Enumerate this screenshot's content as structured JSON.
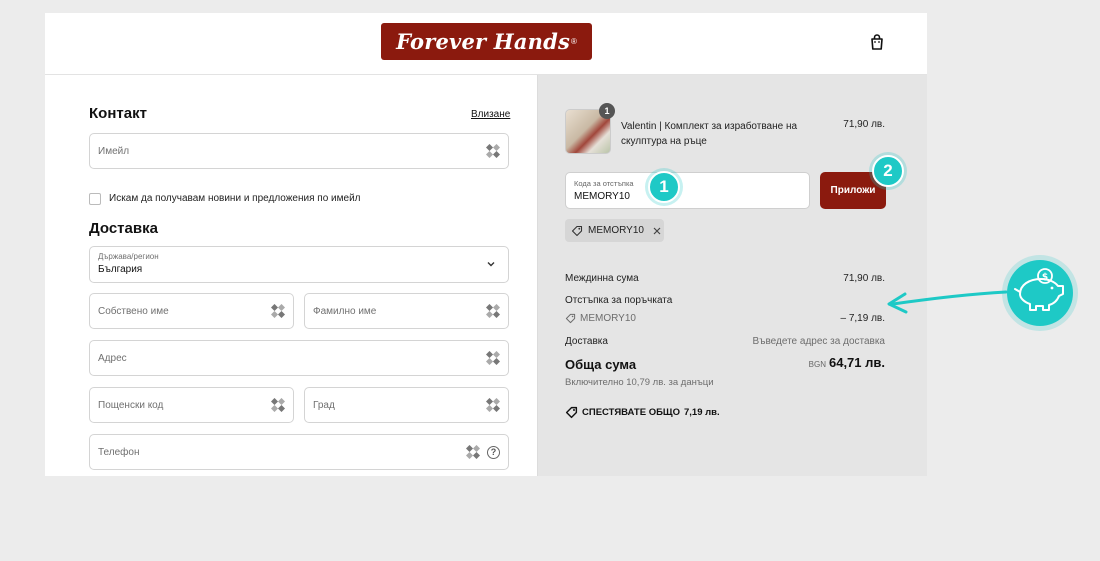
{
  "header": {
    "logo_text": "Forever Hands",
    "logo_mark": "®",
    "cart_icon": "shopping-bag-icon"
  },
  "contact": {
    "heading": "Контакт",
    "login_link": "Влизане",
    "email_placeholder": "Имейл",
    "newsletter_label": "Искам да получавам новини и предложения по имейл"
  },
  "delivery": {
    "heading": "Доставка",
    "country_label": "Държава/регион",
    "country_value": "България",
    "first_name_placeholder": "Собствено име",
    "last_name_placeholder": "Фамилно име",
    "address_placeholder": "Адрес",
    "postcode_placeholder": "Пощенски код",
    "city_placeholder": "Град",
    "phone_placeholder": "Телефон",
    "help_glyph": "?"
  },
  "summary": {
    "product": {
      "qty": "1",
      "name": "Valentin | Комплект за изработване на скулптура на ръце",
      "price": "71,90 лв."
    },
    "discount_field": {
      "label": "Кода за отстъпка",
      "value": "MEMORY10"
    },
    "apply_label": "Приложи",
    "chip_code": "MEMORY10",
    "subtotal_label": "Междинна сума",
    "subtotal_value": "71,90 лв.",
    "order_discount_label": "Отстъпка за поръчката",
    "discount_code": "MEMORY10",
    "discount_value": "– 7,19 лв.",
    "shipping_label": "Доставка",
    "shipping_value": "Въведете адрес за доставка",
    "total_label": "Обща сума",
    "currency": "BGN",
    "total_value": "64,71 лв.",
    "tax_note": "Включително 10,79 лв. за данъци",
    "savings_label": "СПЕСТЯВАТЕ ОБЩО",
    "savings_value": "7,19 лв."
  },
  "annotations": {
    "badge_1": "1",
    "badge_2": "2",
    "accent_color": "#1ec9c6"
  },
  "colors": {
    "brand": "#8b1a0e",
    "summary_bg": "#e5e5e5",
    "page_bg": "#ececec"
  }
}
